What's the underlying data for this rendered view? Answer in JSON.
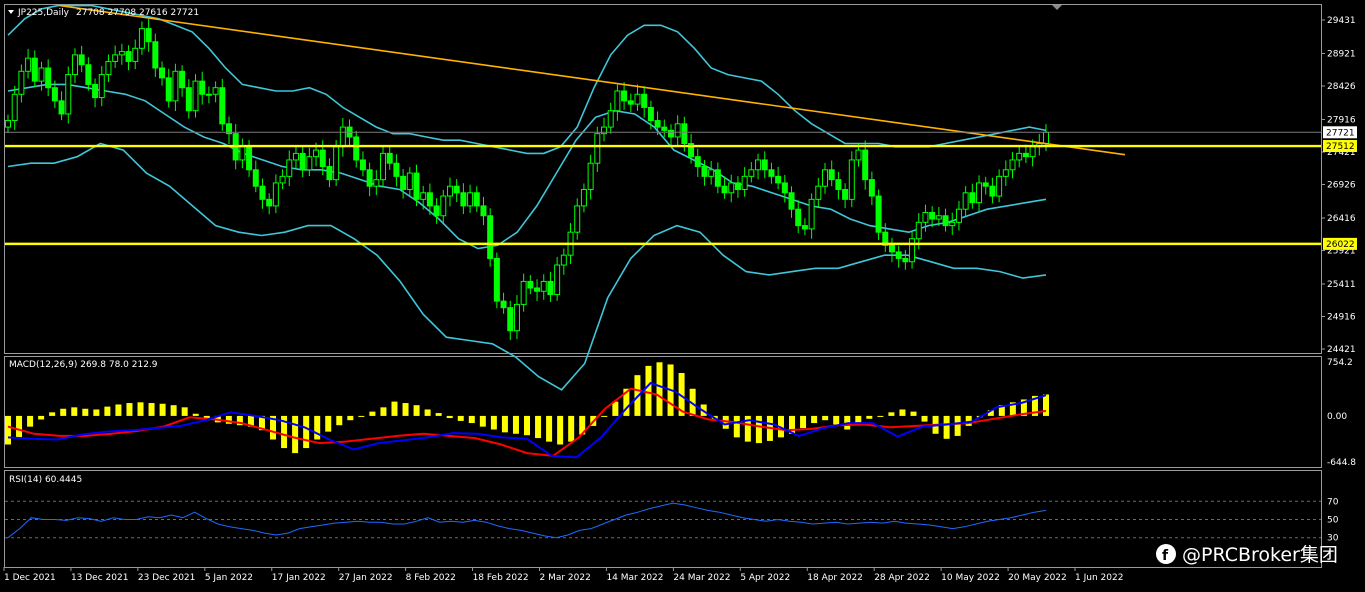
{
  "window": {
    "symbol_header": "JP225,Daily",
    "ohlc_header": "27708 27708 27616 27721"
  },
  "watermark": "@PRCBroker集团",
  "colors": {
    "background": "#000000",
    "bull": "#00ff00",
    "bear": "#00ff00",
    "bollinger": "#3fc6d8",
    "trendline": "#ffb300",
    "levels": "#ffff00",
    "macd_hist": "#ffff00",
    "macd_line": "#0000ff",
    "signal_line": "#ff0000",
    "rsi_line": "#1e6bff",
    "grid": "#6b6b6b"
  },
  "chart_data": [
    {
      "type": "candlestick",
      "title": "JP225,Daily",
      "y_ticks": [
        "29431",
        "28921",
        "28426",
        "27916",
        "27421",
        "26926",
        "26416",
        "25921",
        "25411",
        "24916",
        "24421"
      ],
      "ylim": [
        24421,
        29431
      ],
      "current_price_label": "27721",
      "horizontal_levels": [
        {
          "label": "27512",
          "value": 27512
        },
        {
          "label": "26022",
          "value": 26022
        }
      ],
      "trendline": {
        "from": [
          "1 Dec 2021",
          29650
        ],
        "to": [
          "1 Jun 2022",
          27380
        ]
      },
      "x_tick_labels": [
        "1 Dec 2021",
        "13 Dec 2021",
        "23 Dec 2021",
        "5 Jan 2022",
        "17 Jan 2022",
        "27 Jan 2022",
        "8 Feb 2022",
        "18 Feb 2022",
        "2 Mar 2022",
        "14 Mar 2022",
        "24 Mar 2022",
        "5 Apr 2022",
        "18 Apr 2022",
        "28 Apr 2022",
        "10 May 2022",
        "20 May 2022",
        "1 Jun 2022"
      ],
      "series_close": [
        27900,
        28300,
        28650,
        28850,
        28500,
        28700,
        28400,
        28200,
        28000,
        28600,
        28900,
        28750,
        28450,
        28250,
        28600,
        28800,
        28900,
        28950,
        28800,
        29000,
        29300,
        29100,
        28700,
        28550,
        28200,
        28650,
        28400,
        28050,
        28500,
        28300,
        28300,
        28400,
        27850,
        27700,
        27300,
        27500,
        27150,
        26900,
        26700,
        26600,
        26950,
        27050,
        27300,
        27400,
        27150,
        27350,
        27450,
        27200,
        27000,
        27500,
        27800,
        27650,
        27300,
        27150,
        26900,
        27000,
        27400,
        27250,
        27050,
        26850,
        27100,
        26700,
        26800,
        26600,
        26450,
        26750,
        26900,
        26800,
        26600,
        26800,
        26600,
        26450,
        25800,
        25150,
        25050,
        24700,
        25100,
        25450,
        25350,
        25300,
        25450,
        25250,
        25700,
        25850,
        26200,
        26600,
        26850,
        27250,
        27700,
        27800,
        28050,
        28350,
        28200,
        28150,
        28300,
        28100,
        27900,
        27800,
        27750,
        27650,
        27850,
        27550,
        27350,
        27200,
        27050,
        27150,
        26900,
        26800,
        26950,
        26850,
        27050,
        27150,
        27300,
        27150,
        27050,
        26950,
        26800,
        26550,
        26300,
        26250,
        26700,
        26900,
        27150,
        27000,
        26850,
        26700,
        27300,
        27450,
        27000,
        26750,
        26200,
        26000,
        25900,
        25800,
        25750,
        26100,
        26350,
        26500,
        26400,
        26450,
        26300,
        26350,
        26550,
        26800,
        26650,
        26950,
        26900,
        26750,
        27050,
        27150,
        27300,
        27400,
        27350,
        27500,
        27550,
        27721
      ],
      "bollinger_upper": [
        29200,
        29450,
        29600,
        29650,
        29650,
        29650,
        29600,
        29550,
        29500,
        29450,
        29350,
        29250,
        29000,
        28700,
        28450,
        28400,
        28350,
        28350,
        28400,
        28300,
        28100,
        27950,
        27800,
        27700,
        27700,
        27650,
        27600,
        27600,
        27550,
        27500,
        27450,
        27400,
        27400,
        27500,
        27800,
        28400,
        28900,
        29200,
        29350,
        29350,
        29250,
        29000,
        28700,
        28600,
        28550,
        28500,
        28300,
        28050,
        27850,
        27700,
        27550,
        27550,
        27550,
        27500,
        27500,
        27500,
        27550,
        27600,
        27650,
        27700,
        27750,
        27800,
        27750
      ],
      "bollinger_mid": [
        28350,
        28400,
        28450,
        28450,
        28400,
        28350,
        28300,
        28200,
        28000,
        27800,
        27650,
        27550,
        27400,
        27300,
        27200,
        27150,
        27150,
        27100,
        27000,
        26900,
        26850,
        26650,
        26400,
        26100,
        25950,
        26000,
        26200,
        26600,
        27100,
        27600,
        27950,
        28050,
        28000,
        27800,
        27450,
        27300,
        27150,
        26950,
        26900,
        26800,
        26700,
        26600,
        26550,
        26400,
        26300,
        26250,
        26200,
        26300,
        26350,
        26450,
        26550,
        26600,
        26650,
        26700
      ],
      "bollinger_lower": [
        27200,
        27250,
        27250,
        27350,
        27550,
        27450,
        27100,
        26900,
        26600,
        26300,
        26200,
        26150,
        26200,
        26300,
        26300,
        26100,
        25850,
        25450,
        24950,
        24600,
        24550,
        24500,
        24300,
        24000,
        23800,
        24200,
        25200,
        25800,
        26150,
        26300,
        26200,
        25850,
        25600,
        25550,
        25600,
        25650,
        25650,
        25750,
        25850,
        25850,
        25750,
        25650,
        25650,
        25600,
        25500,
        25550
      ]
    },
    {
      "type": "bar",
      "title": "MACD(12,26,9) 269.8 78.0 212.9",
      "y_ticks": [
        "754.2",
        "0.00",
        "-644.8"
      ],
      "ylim": [
        -644.8,
        754.2
      ],
      "series": [
        {
          "name": "histogram",
          "values": [
            -400,
            -300,
            -150,
            -50,
            50,
            100,
            120,
            100,
            90,
            130,
            160,
            180,
            190,
            180,
            170,
            150,
            120,
            30,
            -60,
            -90,
            -110,
            -130,
            -150,
            -200,
            -330,
            -450,
            -520,
            -450,
            -330,
            -220,
            -130,
            -60,
            0,
            60,
            120,
            200,
            180,
            150,
            90,
            40,
            -30,
            -70,
            -100,
            -150,
            -190,
            -230,
            -250,
            -270,
            -310,
            -360,
            -400,
            -360,
            -260,
            -140,
            0,
            200,
            380,
            570,
            700,
            750,
            720,
            600,
            380,
            160,
            -40,
            -180,
            -300,
            -360,
            -380,
            -350,
            -300,
            -250,
            -170,
            -100,
            -60,
            -120,
            -190,
            -100,
            -40,
            -10,
            50,
            90,
            60,
            -80,
            -250,
            -320,
            -280,
            -140,
            -20,
            80,
            150,
            190,
            230,
            280,
            300
          ]
        },
        {
          "name": "macd",
          "values": [
            -300,
            -320,
            -330,
            -260,
            -220,
            -200,
            -170,
            -140,
            -60,
            50,
            0,
            -60,
            -160,
            -330,
            -470,
            -380,
            -340,
            -300,
            -240,
            -250,
            -300,
            -320,
            -560,
            -580,
            -300,
            100,
            460,
            340,
            100,
            -120,
            -60,
            -120,
            -280,
            -170,
            -100,
            -100,
            -290,
            -150,
            -120,
            -80,
            120,
            180,
            290
          ]
        },
        {
          "name": "signal",
          "values": [
            -150,
            -250,
            -280,
            -280,
            -250,
            -210,
            -150,
            -20,
            -50,
            -100,
            -200,
            -300,
            -380,
            -360,
            -320,
            -280,
            -250,
            -280,
            -310,
            -400,
            -520,
            -560,
            -300,
            100,
            380,
            300,
            60,
            -50,
            -90,
            -150,
            -200,
            -180,
            -130,
            -120,
            -160,
            -140,
            -120,
            -100,
            -40,
            20,
            70
          ]
        }
      ]
    },
    {
      "type": "line",
      "title": "RSI(14) 60.4445",
      "y_ticks": [
        "70",
        "50",
        "30"
      ],
      "ylim": [
        0,
        100
      ],
      "levels": [
        70,
        50,
        30
      ],
      "series": [
        {
          "name": "RSI(14)",
          "values": [
            30,
            40,
            52,
            50,
            50,
            49,
            52,
            51,
            48,
            52,
            50,
            50,
            53,
            52,
            55,
            52,
            58,
            51,
            45,
            42,
            40,
            38,
            35,
            33,
            35,
            40,
            42,
            44,
            46,
            47,
            48,
            47,
            47,
            45,
            45,
            48,
            52,
            47,
            48,
            47,
            49,
            47,
            43,
            40,
            38,
            35,
            32,
            30,
            33,
            38,
            40,
            45,
            50,
            55,
            58,
            62,
            65,
            68,
            66,
            63,
            60,
            58,
            55,
            52,
            50,
            48,
            50,
            48,
            47,
            45,
            46,
            47,
            45,
            46,
            47,
            46,
            48,
            46,
            45,
            44,
            42,
            40,
            42,
            45,
            48,
            50,
            52,
            55,
            58,
            60
          ]
        }
      ]
    }
  ]
}
